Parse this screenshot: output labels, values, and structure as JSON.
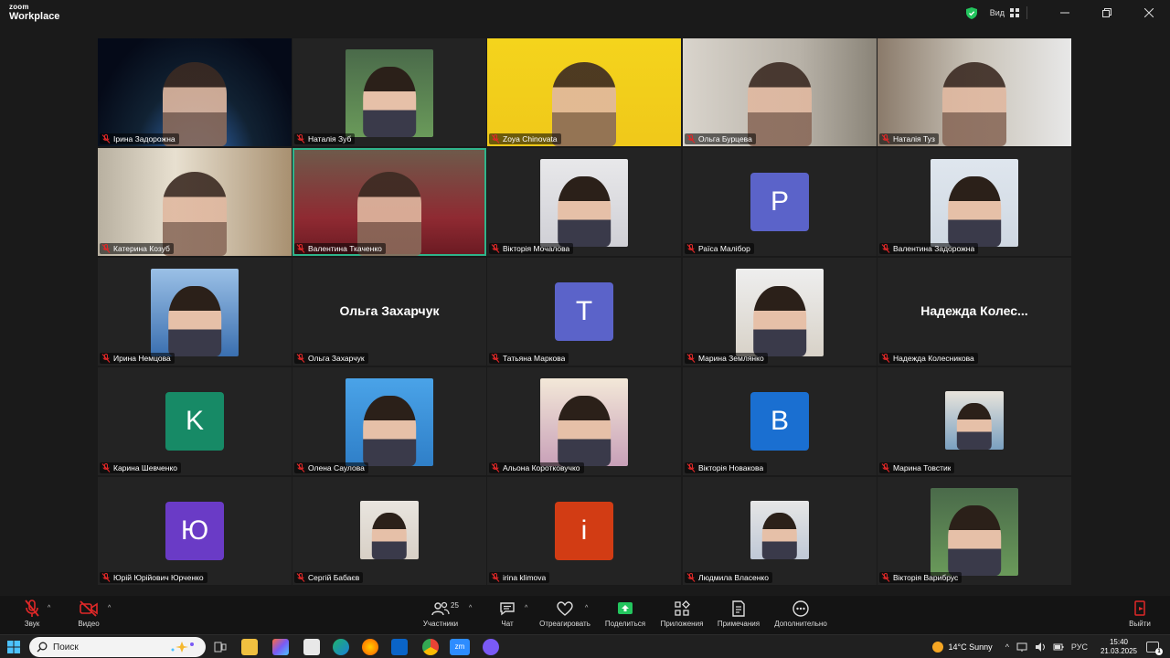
{
  "app": {
    "brand_top": "zoom",
    "brand_bottom": "Workplace",
    "view_label": "Вид"
  },
  "colors": {
    "active_outline": "#2fb48a",
    "mic_off": "#e02828",
    "tile_bg": "#232323"
  },
  "participants": [
    {
      "name": "Ірина Задорожна",
      "kind": "video"
    },
    {
      "name": "Наталія Зуб",
      "kind": "photo"
    },
    {
      "name": "Zoya Chinovata",
      "kind": "video"
    },
    {
      "name": "Ольга Бурцева",
      "kind": "video"
    },
    {
      "name": "Наталія Туз",
      "kind": "video"
    },
    {
      "name": "Катерина Козуб",
      "kind": "video"
    },
    {
      "name": "Валентина Ткаченко",
      "kind": "video",
      "active": true
    },
    {
      "name": "Вікторія Мочалова",
      "kind": "photo"
    },
    {
      "name": "Раїса Малібор",
      "kind": "letter",
      "letter": "P",
      "color": "#5b63c9"
    },
    {
      "name": "Валентина Задорожна",
      "kind": "photo"
    },
    {
      "name": "Ирина Немцова",
      "kind": "photo"
    },
    {
      "name": "Ольга Захарчук",
      "kind": "text",
      "display": "Ольга Захарчук"
    },
    {
      "name": "Татьяна Маркова",
      "kind": "letter",
      "letter": "T",
      "color": "#5b63c9"
    },
    {
      "name": "Марина Землянко",
      "kind": "photo"
    },
    {
      "name": "Надежда Колесникова",
      "kind": "text",
      "display": "Надежда Колес..."
    },
    {
      "name": "Карина Шевченко",
      "kind": "letter",
      "letter": "K",
      "color": "#178a66"
    },
    {
      "name": "Олена Саулова",
      "kind": "photo"
    },
    {
      "name": "Альона Коротковучко",
      "kind": "photo"
    },
    {
      "name": "Вікторія Новакова",
      "kind": "letter",
      "letter": "B",
      "color": "#1a6fd1"
    },
    {
      "name": "Марина Товстик",
      "kind": "photo",
      "small": true
    },
    {
      "name": "Юрій Юрійович Юрченко",
      "kind": "letter",
      "letter": "Ю",
      "color": "#6a3bc6"
    },
    {
      "name": "Сергій Бабаєв",
      "kind": "photo",
      "small": true
    },
    {
      "name": "irina klimova",
      "kind": "letter",
      "letter": "i",
      "color": "#d23c14"
    },
    {
      "name": "Людмила Власенко",
      "kind": "photo",
      "small": true
    },
    {
      "name": "Вікторія Варибрус",
      "kind": "photo"
    }
  ],
  "toolbar": {
    "audio": "Звук",
    "video": "Видео",
    "participants": "Участники",
    "participants_count": "25",
    "chat": "Чат",
    "react": "Отреагировать",
    "share": "Поделиться",
    "apps": "Приложения",
    "notes": "Примечания",
    "more": "Дополнительно",
    "leave": "Выйти"
  },
  "taskbar": {
    "search_placeholder": "Поиск",
    "weather": "14°C  Sunny",
    "language": "РУС",
    "time": "15:40",
    "date": "21.03.2025",
    "notification_count": "1"
  }
}
